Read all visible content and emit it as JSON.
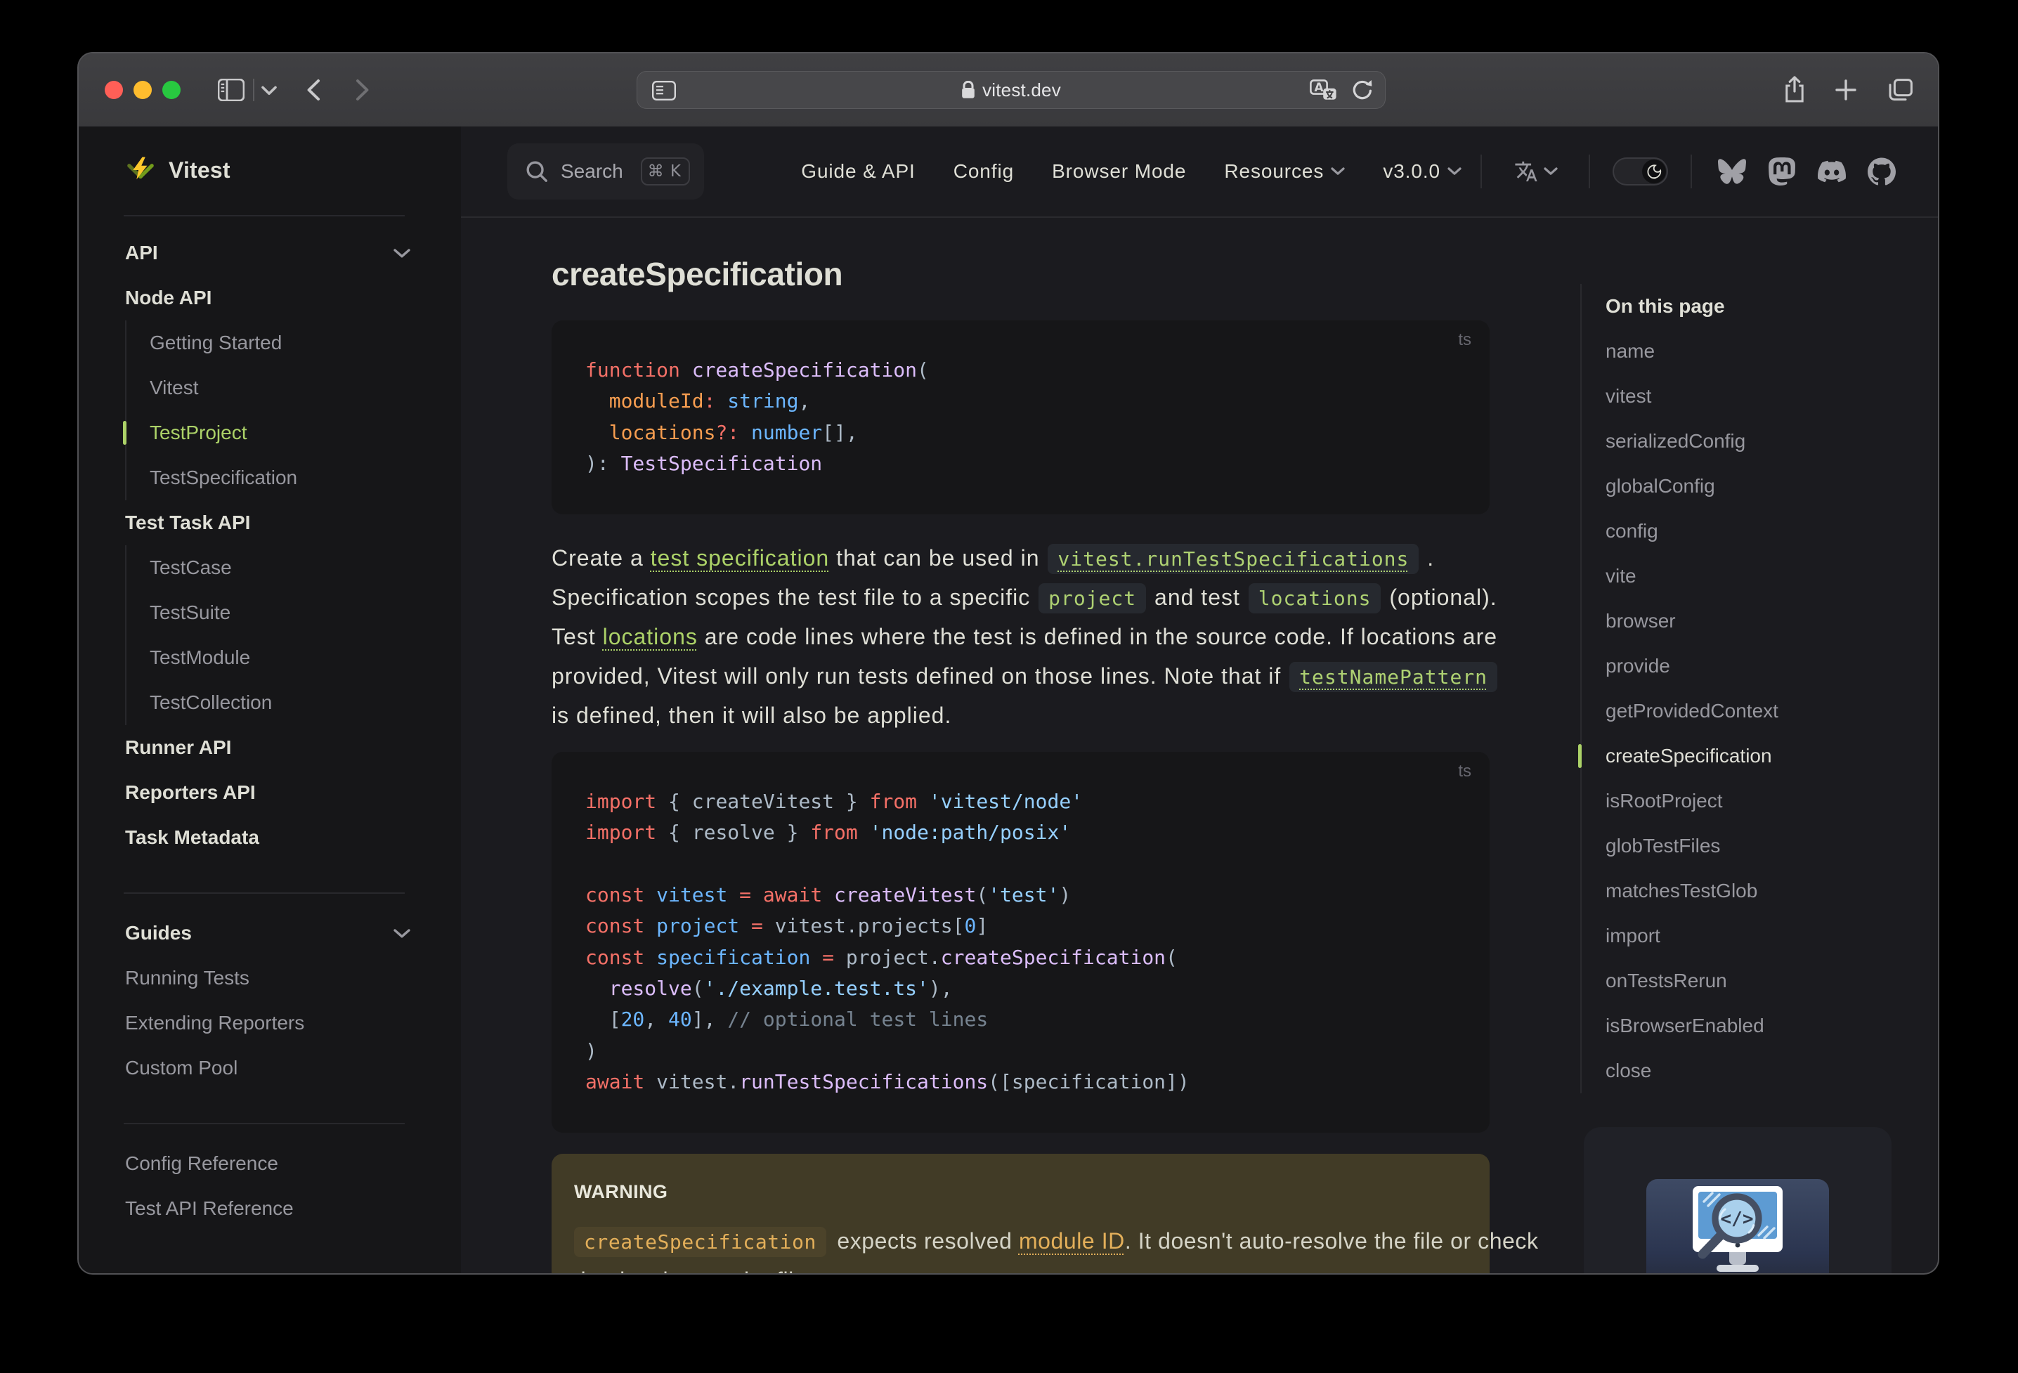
{
  "browser": {
    "url": "vitest.dev",
    "traffic_lights": {
      "close": "#ff5f57",
      "minimize": "#febc2e",
      "zoom": "#28c840"
    },
    "titlebar_icons": [
      "sidebar-toggle-icon",
      "sidebar-chevron-icon",
      "back-arrow-icon",
      "forward-arrow-icon",
      "page-settings-icon",
      "lock-icon",
      "translate-icon",
      "reload-icon",
      "share-icon",
      "new-tab-icon",
      "tab-overview-icon"
    ]
  },
  "nav": {
    "search": {
      "label": "Search",
      "kbd": "⌘ K"
    },
    "menu": [
      {
        "label": "Guide & API"
      },
      {
        "label": "Config"
      },
      {
        "label": "Browser Mode"
      },
      {
        "label": "Resources",
        "chevron": true
      },
      {
        "label": "v3.0.0",
        "chevron": true
      }
    ],
    "icons": [
      "translate-icon",
      "moon-icon"
    ],
    "theme_toggle_state": "dark",
    "social": [
      "bluesky",
      "mastodon",
      "discord",
      "github"
    ]
  },
  "sidebar": {
    "logo_text": "Vitest",
    "sections": [
      {
        "type": "header",
        "label": "API",
        "chevron": true
      },
      {
        "type": "section",
        "label": "Node API"
      },
      {
        "type": "group",
        "items": [
          {
            "label": "Getting Started"
          },
          {
            "label": "Vitest"
          },
          {
            "label": "TestProject",
            "active": true
          },
          {
            "label": "TestSpecification"
          }
        ]
      },
      {
        "type": "section",
        "label": "Test Task API"
      },
      {
        "type": "group",
        "items": [
          {
            "label": "TestCase"
          },
          {
            "label": "TestSuite"
          },
          {
            "label": "TestModule"
          },
          {
            "label": "TestCollection"
          }
        ]
      },
      {
        "type": "section",
        "label": "Runner API"
      },
      {
        "type": "section",
        "label": "Reporters API"
      },
      {
        "type": "section",
        "label": "Task Metadata"
      },
      {
        "type": "divider"
      },
      {
        "type": "header",
        "label": "Guides",
        "chevron": true
      },
      {
        "type": "item",
        "label": "Running Tests"
      },
      {
        "type": "item",
        "label": "Extending Reporters"
      },
      {
        "type": "item",
        "label": "Custom Pool"
      },
      {
        "type": "divider"
      },
      {
        "type": "item",
        "label": "Config Reference"
      },
      {
        "type": "item",
        "label": "Test API Reference"
      }
    ]
  },
  "content": {
    "title": "createSpecification",
    "code_blocks": {
      "signature": {
        "lang": "ts",
        "lines": [
          [
            {
              "c": "kw",
              "t": "function"
            },
            {
              "c": "fg",
              "t": " "
            },
            {
              "c": "fn",
              "t": "createSpecification"
            },
            {
              "c": "fg",
              "t": "("
            }
          ],
          [
            {
              "c": "fg",
              "t": "  "
            },
            {
              "c": "pr",
              "t": "moduleId"
            },
            {
              "c": "kw",
              "t": ":"
            },
            {
              "c": "fg",
              "t": " "
            },
            {
              "c": "nm",
              "t": "string"
            },
            {
              "c": "fg",
              "t": ","
            }
          ],
          [
            {
              "c": "fg",
              "t": "  "
            },
            {
              "c": "pr",
              "t": "locations"
            },
            {
              "c": "kw",
              "t": "?:"
            },
            {
              "c": "fg",
              "t": " "
            },
            {
              "c": "nm",
              "t": "number"
            },
            {
              "c": "fg",
              "t": "[],"
            }
          ],
          [
            {
              "c": "fg",
              "t": "): "
            },
            {
              "c": "fn",
              "t": "TestSpecification"
            }
          ]
        ]
      },
      "example": {
        "lang": "ts",
        "lines": [
          [
            {
              "c": "kw",
              "t": "import"
            },
            {
              "c": "fg",
              "t": " { createVitest } "
            },
            {
              "c": "kw",
              "t": "from"
            },
            {
              "c": "fg",
              "t": " "
            },
            {
              "c": "st",
              "t": "'vitest/node'"
            }
          ],
          [
            {
              "c": "kw",
              "t": "import"
            },
            {
              "c": "fg",
              "t": " { resolve } "
            },
            {
              "c": "kw",
              "t": "from"
            },
            {
              "c": "fg",
              "t": " "
            },
            {
              "c": "st",
              "t": "'node:path/posix'"
            }
          ],
          [],
          [
            {
              "c": "kw",
              "t": "const"
            },
            {
              "c": "fg",
              "t": " "
            },
            {
              "c": "nm",
              "t": "vitest"
            },
            {
              "c": "fg",
              "t": " "
            },
            {
              "c": "kw",
              "t": "="
            },
            {
              "c": "fg",
              "t": " "
            },
            {
              "c": "kw",
              "t": "await"
            },
            {
              "c": "fg",
              "t": " "
            },
            {
              "c": "fn",
              "t": "createVitest"
            },
            {
              "c": "fg",
              "t": "("
            },
            {
              "c": "st",
              "t": "'test'"
            },
            {
              "c": "fg",
              "t": ")"
            }
          ],
          [
            {
              "c": "kw",
              "t": "const"
            },
            {
              "c": "fg",
              "t": " "
            },
            {
              "c": "nm",
              "t": "project"
            },
            {
              "c": "fg",
              "t": " "
            },
            {
              "c": "kw",
              "t": "="
            },
            {
              "c": "fg",
              "t": " vitest.projects["
            },
            {
              "c": "nm",
              "t": "0"
            },
            {
              "c": "fg",
              "t": "]"
            }
          ],
          [
            {
              "c": "kw",
              "t": "const"
            },
            {
              "c": "fg",
              "t": " "
            },
            {
              "c": "nm",
              "t": "specification"
            },
            {
              "c": "fg",
              "t": " "
            },
            {
              "c": "kw",
              "t": "="
            },
            {
              "c": "fg",
              "t": " project."
            },
            {
              "c": "fn",
              "t": "createSpecification"
            },
            {
              "c": "fg",
              "t": "("
            }
          ],
          [
            {
              "c": "fg",
              "t": "  "
            },
            {
              "c": "fn",
              "t": "resolve"
            },
            {
              "c": "fg",
              "t": "("
            },
            {
              "c": "st",
              "t": "'./example.test.ts'"
            },
            {
              "c": "fg",
              "t": "),"
            }
          ],
          [
            {
              "c": "fg",
              "t": "  ["
            },
            {
              "c": "nm",
              "t": "20"
            },
            {
              "c": "fg",
              "t": ", "
            },
            {
              "c": "nm",
              "t": "40"
            },
            {
              "c": "fg",
              "t": "], "
            },
            {
              "c": "cm",
              "t": "// optional test lines"
            }
          ],
          [
            {
              "c": "fg",
              "t": ")"
            }
          ],
          [
            {
              "c": "kw",
              "t": "await"
            },
            {
              "c": "fg",
              "t": " vitest."
            },
            {
              "c": "fn",
              "t": "runTestSpecifications"
            },
            {
              "c": "fg",
              "t": "([specification])"
            }
          ]
        ]
      }
    },
    "paragraph": [
      [
        {
          "y": "tx",
          "t": "Create a "
        },
        {
          "y": "lk",
          "t": "test specification"
        },
        {
          "y": "tx",
          "t": " that can be used in "
        },
        {
          "y": "cl",
          "t": "vitest.runTestSpecifications"
        },
        {
          "y": "tx",
          "t": " ."
        }
      ],
      [
        {
          "y": "tx",
          "t": "Specification scopes the test file to a specific "
        },
        {
          "y": "cd",
          "t": "project"
        },
        {
          "y": "tx",
          "t": " and test "
        },
        {
          "y": "cd",
          "t": "locations"
        },
        {
          "y": "tx",
          "t": " (optional)."
        }
      ],
      [
        {
          "y": "tx",
          "t": "Test "
        },
        {
          "y": "lk",
          "t": "locations"
        },
        {
          "y": "tx",
          "t": " are code lines where the test is defined in the source code. If locations are"
        }
      ],
      [
        {
          "y": "tx",
          "t": "provided, Vitest will only run tests defined on those lines. Note that if "
        },
        {
          "y": "cl",
          "t": "testNamePattern"
        }
      ],
      [
        {
          "y": "tx",
          "t": "is defined, then it will also be applied."
        }
      ]
    ],
    "warning": {
      "title": "WARNING",
      "body": [
        [
          {
            "y": "cw",
            "t": "createSpecification"
          },
          {
            "y": "tx",
            "t": " expects resolved "
          },
          {
            "y": "lw",
            "t": "module ID"
          },
          {
            "y": "tx",
            "t": ". It doesn't auto-resolve the file or check"
          }
        ],
        [
          {
            "y": "tx",
            "t": "that it exists on the file system."
          }
        ]
      ]
    }
  },
  "aside": {
    "title": "On this page",
    "items": [
      "name",
      "vitest",
      "serializedConfig",
      "globalConfig",
      "config",
      "vite",
      "browser",
      "provide",
      "getProvidedContext",
      "createSpecification",
      "isRootProject",
      "globTestFiles",
      "matchesTestGlob",
      "import",
      "onTestsRerun",
      "isBrowserEnabled",
      "close"
    ],
    "active_item": "createSpecification"
  },
  "colors": {
    "brand_green": "#acd268",
    "page_bg": "#1b1b1f",
    "panel_bg": "#161618",
    "text_primary": "#dfdfd6",
    "text_secondary": "#98989f",
    "warning_bg": "#413b26",
    "warning_accent": "#e3af5a",
    "code_keyword": "#f47067",
    "code_function": "#dcbdfb",
    "code_param": "#f69d50",
    "code_constant": "#6cb6ff",
    "code_string": "#96d0ff",
    "code_comment": "#768390",
    "code_fg": "#adbac7"
  }
}
